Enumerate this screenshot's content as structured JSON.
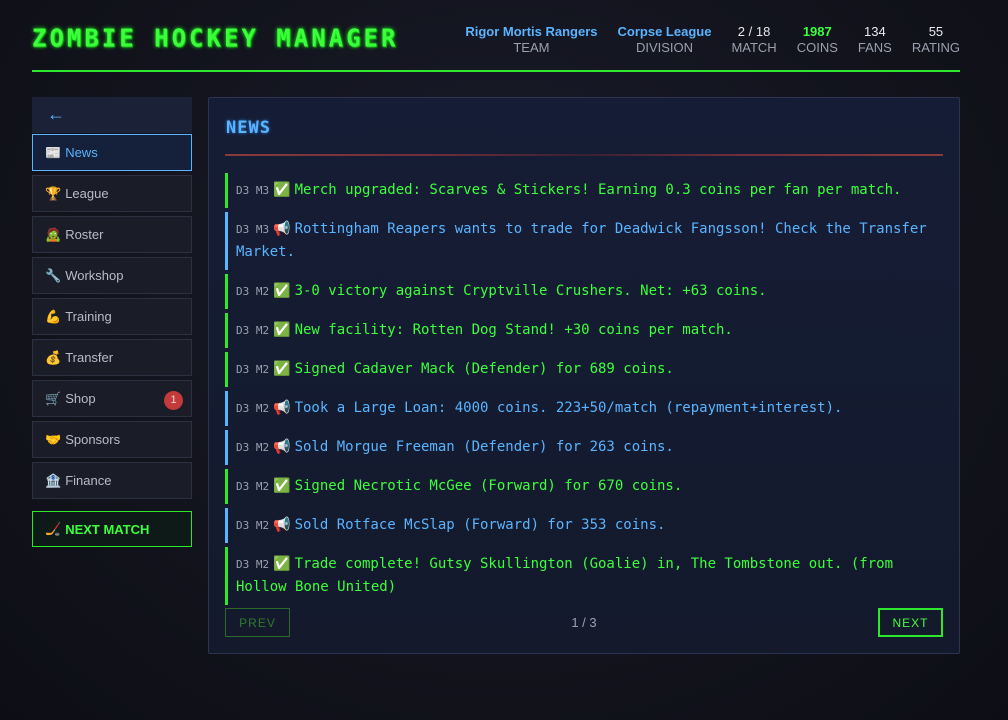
{
  "header": {
    "logo": "ZOMBIE HOCKEY MANAGER",
    "stats": [
      {
        "value": "Rigor Mortis Rangers",
        "label": "TEAM"
      },
      {
        "value": "Corpse League",
        "label": "DIVISION"
      },
      {
        "value": "2 / 18",
        "label": "MATCH"
      },
      {
        "value": "1987",
        "label": "COINS"
      },
      {
        "value": "134",
        "label": "FANS"
      },
      {
        "value": "55",
        "label": "RATING"
      }
    ]
  },
  "sidebar": {
    "back": "←",
    "items": [
      {
        "icon": "📰",
        "icon_name": "newspaper-icon",
        "label": "News"
      },
      {
        "icon": "🏆",
        "icon_name": "trophy-icon",
        "label": "League"
      },
      {
        "icon": "🧟",
        "icon_name": "zombie-icon",
        "label": "Roster"
      },
      {
        "icon": "🔧",
        "icon_name": "wrench-icon",
        "label": "Workshop"
      },
      {
        "icon": "💪",
        "icon_name": "flexed-arm-icon",
        "label": "Training"
      },
      {
        "icon": "💰",
        "icon_name": "money-bag-icon",
        "label": "Transfer"
      },
      {
        "icon": "🛒",
        "icon_name": "shopping-cart-icon",
        "label": "Shop",
        "badge": "1"
      },
      {
        "icon": "🤝",
        "icon_name": "handshake-icon",
        "label": "Sponsors"
      },
      {
        "icon": "🏦",
        "icon_name": "bank-icon",
        "label": "Finance"
      }
    ],
    "next_match": {
      "icon": "🏒",
      "icon_name": "hockey-stick-icon",
      "label": "NEXT MATCH"
    }
  },
  "main": {
    "title": "NEWS",
    "news": [
      {
        "ts": "D3 M3",
        "emoji": "✅",
        "type": "success",
        "text": "Merch upgraded: Scarves & Stickers! Earning 0.3 coins per fan per match."
      },
      {
        "ts": "D3 M3",
        "emoji": "📢",
        "type": "info",
        "text": "Rottingham Reapers wants to trade for Deadwick Fangsson! Check the Transfer Market."
      },
      {
        "ts": "D3 M2",
        "emoji": "✅",
        "type": "success",
        "text": "3-0 victory against Cryptville Crushers. Net: +63 coins."
      },
      {
        "ts": "D3 M2",
        "emoji": "✅",
        "type": "success",
        "text": "New facility: Rotten Dog Stand! +30 coins per match."
      },
      {
        "ts": "D3 M2",
        "emoji": "✅",
        "type": "success",
        "text": "Signed Cadaver Mack (Defender) for 689 coins."
      },
      {
        "ts": "D3 M2",
        "emoji": "📢",
        "type": "info",
        "text": "Took a Large Loan: 4000 coins. 223+50/match (repayment+interest)."
      },
      {
        "ts": "D3 M2",
        "emoji": "📢",
        "type": "info",
        "text": "Sold Morgue Freeman (Defender) for 263 coins."
      },
      {
        "ts": "D3 M2",
        "emoji": "✅",
        "type": "success",
        "text": "Signed Necrotic McGee (Forward) for 670 coins."
      },
      {
        "ts": "D3 M2",
        "emoji": "📢",
        "type": "info",
        "text": "Sold Rotface McSlap (Forward) for 353 coins."
      },
      {
        "ts": "D3 M2",
        "emoji": "✅",
        "type": "success",
        "text": "Trade complete! Gutsy Skullington (Goalie) in, The Tombstone out. (from Hollow Bone United)"
      }
    ],
    "pager": {
      "prev": "PREV",
      "page": "1 / 3",
      "next": "NEXT"
    }
  }
}
